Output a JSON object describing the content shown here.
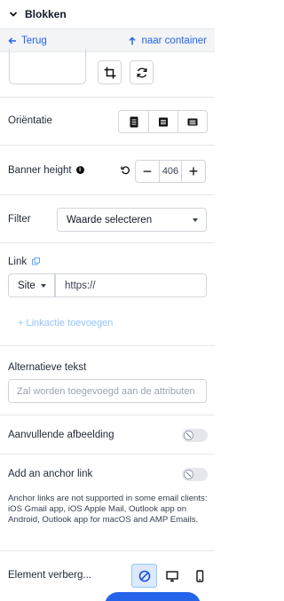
{
  "header": {
    "title": "Blokken",
    "chevron_icon": "chevron-down-icon"
  },
  "nav": {
    "back_label": "Terug",
    "container_label": "naar container"
  },
  "orientation": {
    "label": "Oriëntatie",
    "options": [
      "portrait-icon",
      "landscape-icon",
      "wide-icon"
    ]
  },
  "banner_height": {
    "label": "Banner height",
    "value": "406"
  },
  "filter": {
    "label": "Filter",
    "selected": "Waarde selecteren"
  },
  "link": {
    "label": "Link",
    "type_selected": "Site",
    "url_value": "https://"
  },
  "link_action": {
    "label": "+ Linkactie toevoegen"
  },
  "alt_text": {
    "label": "Alternatieve tekst",
    "placeholder": "Zal worden toegevoegd aan de attributen"
  },
  "extra_image": {
    "label": "Aanvullende afbeelding",
    "enabled": false
  },
  "anchor": {
    "label": "Add an anchor link",
    "enabled": false,
    "note": "Anchor links are not supported in some email clients: iOS Gmail app, iOS Apple Mail, Outlook app on Android, Outlook app for macOS and AMP Emails."
  },
  "element_hide": {
    "label": "Element verberg...",
    "options": [
      "hide-none-icon",
      "desktop-icon",
      "mobile-icon"
    ],
    "active_index": 0
  },
  "colors": {
    "accent": "#2563eb",
    "border": "#d1d5db"
  }
}
